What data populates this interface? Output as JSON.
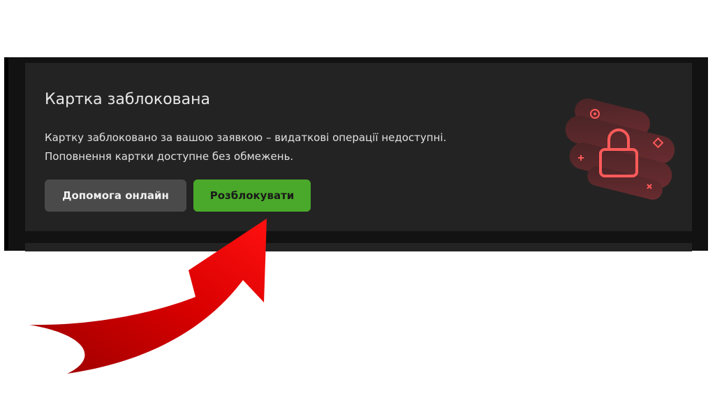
{
  "card": {
    "title": "Картка заблокована",
    "desc_line1": "Картку заблоковано за вашою заявкою – видаткові операції недоступні.",
    "desc_line2": "Поповнення картки доступне без обмежень.",
    "help_button": "Допомога онлайн",
    "unlock_button": "Розблокувати"
  },
  "colors": {
    "card_bg": "#232323",
    "unlock_green": "#4aa92a",
    "help_gray": "#4a4a4a",
    "lock_red": "#ff5a5a",
    "arrow_red": "#d40000"
  },
  "icons": {
    "lock": "lock-icon",
    "arrow": "arrow-annotation"
  }
}
